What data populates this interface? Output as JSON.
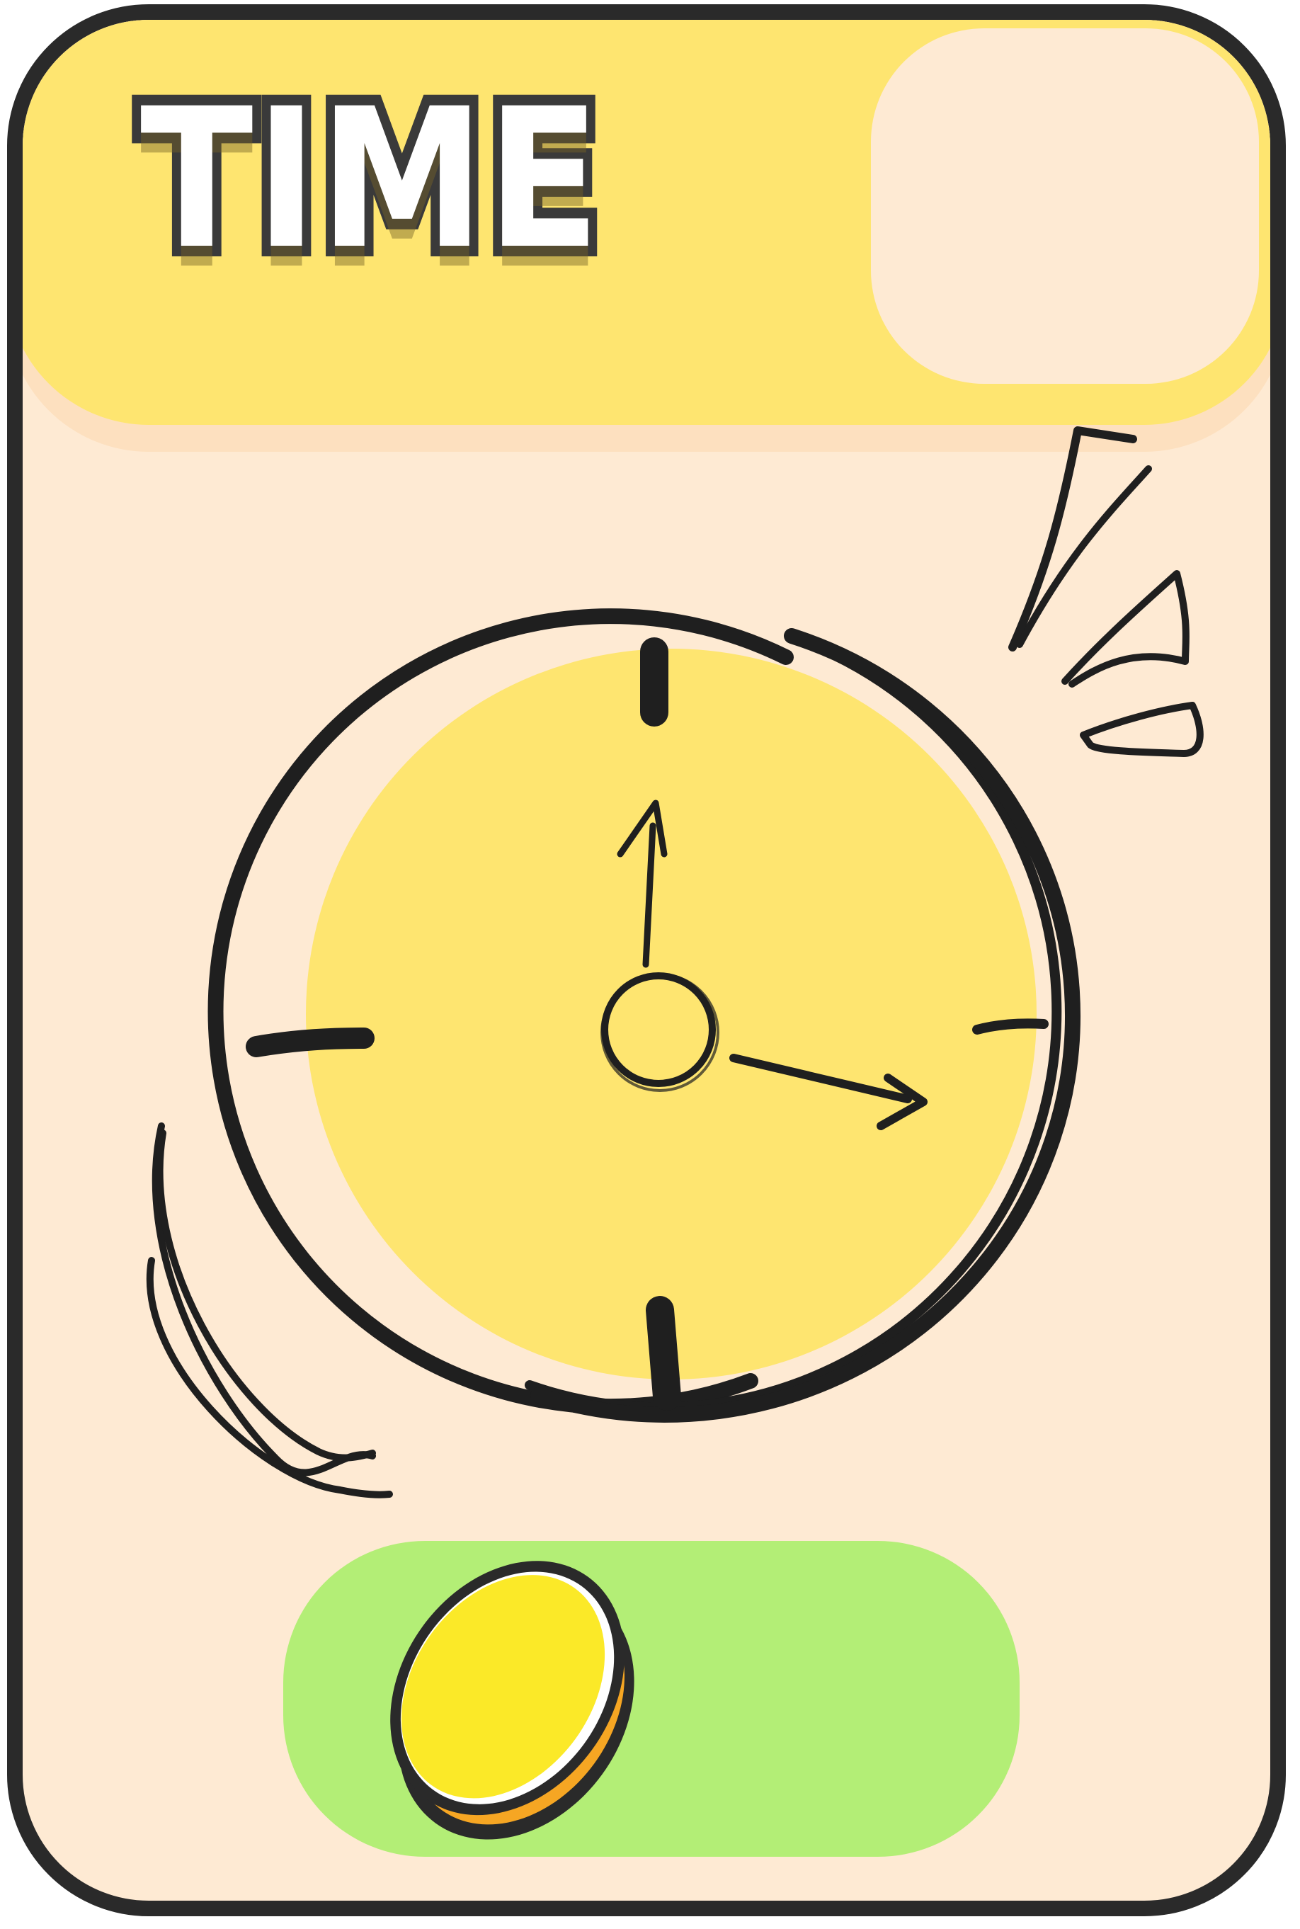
{
  "card": {
    "title": "TIME",
    "colors": {
      "card_bg": "#feead3",
      "header_bg": "#fee570",
      "outline": "#2a2a2a",
      "clock_face": "#fee570",
      "reward_bg": "#b3ee76",
      "coin": "#fbe928",
      "coin_edge": "#f6a623"
    }
  },
  "clock": {
    "icon": "alarm-clock-icon",
    "hour_hand_pointing": "12",
    "minute_hand_pointing": "3"
  },
  "reward": {
    "icon": "gold-coin-icon"
  }
}
